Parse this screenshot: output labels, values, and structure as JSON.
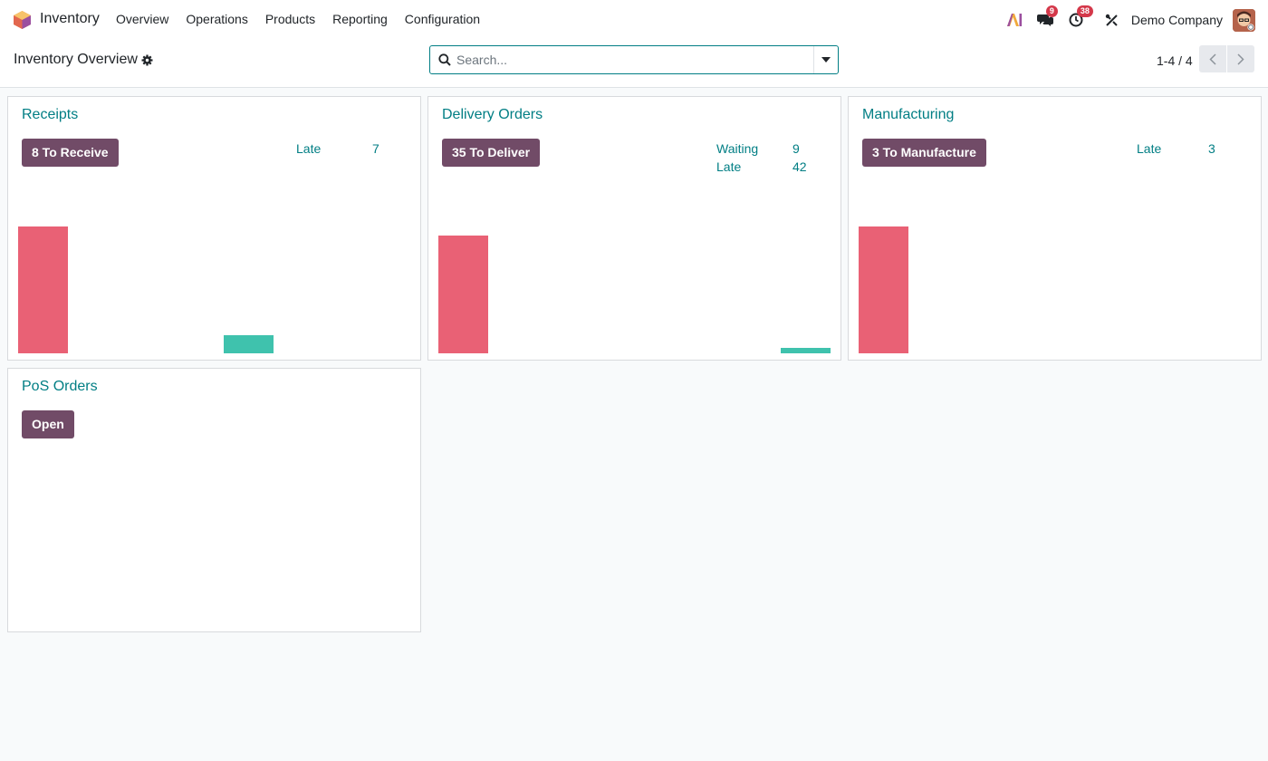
{
  "navbar": {
    "app_name": "Inventory",
    "menu": [
      "Overview",
      "Operations",
      "Products",
      "Reporting",
      "Configuration"
    ],
    "messages_count": "9",
    "activities_count": "38",
    "company": "Demo Company"
  },
  "control": {
    "title": "Inventory Overview",
    "search_placeholder": "Search...",
    "pager": "1-4 / 4"
  },
  "cards": [
    {
      "title": "Receipts",
      "button": "8 To Receive",
      "stats": [
        {
          "label": "Late",
          "value": "7"
        }
      ],
      "graph": {
        "bars": [
          {
            "color": "red",
            "value": 140
          },
          {
            "color": "teal",
            "value": 20
          }
        ]
      }
    },
    {
      "title": "Delivery Orders",
      "button": "35 To Deliver",
      "stats": [
        {
          "label": "Waiting",
          "value": "9"
        },
        {
          "label": "Late",
          "value": "42"
        }
      ],
      "graph": {
        "bars": [
          {
            "color": "red",
            "value": 130
          },
          {
            "color": "teal",
            "value": 6
          }
        ]
      }
    },
    {
      "title": "Manufacturing",
      "button": "3 To Manufacture",
      "stats": [
        {
          "label": "Late",
          "value": "3"
        }
      ],
      "graph": {
        "bars": [
          {
            "color": "red",
            "value": 140
          }
        ]
      }
    },
    {
      "title": "PoS Orders",
      "button": "Open",
      "stats": [],
      "graph": {
        "bars": []
      }
    }
  ],
  "colors": {
    "accent": "#017e84",
    "primary_button": "#714b67",
    "bar_red": "#e96175",
    "bar_teal": "#3fc2ad"
  }
}
